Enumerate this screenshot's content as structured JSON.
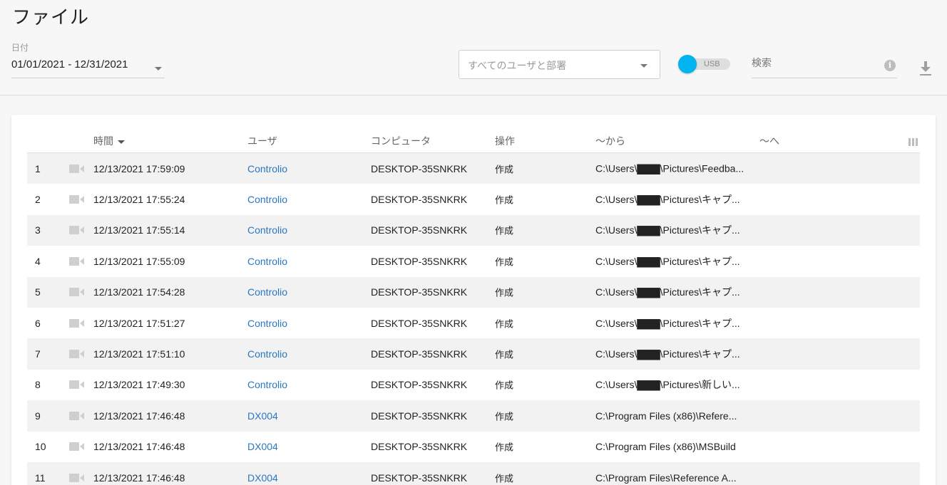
{
  "page": {
    "title": "ファイル"
  },
  "filters": {
    "date_label": "日付",
    "date_value": "01/01/2021 - 12/31/2021",
    "user_select_placeholder": "すべてのユーザと部署",
    "usb_toggle_label": "USB",
    "search_placeholder": "検索",
    "info_icon_glyph": "i"
  },
  "colors": {
    "accent": "#00b4f0",
    "link": "#2a77c0"
  },
  "icons": {
    "row_icon": "video-camera-icon",
    "download": "download-icon",
    "info": "info-icon",
    "columns": "columns-icon"
  },
  "table": {
    "headers": {
      "time": "時間",
      "user": "ユーザ",
      "computer": "コンピュータ",
      "operation": "操作",
      "from": "～から",
      "to": "～へ"
    },
    "rows": [
      {
        "idx": "1",
        "time": "12/13/2021 17:59:09",
        "user": "Controlio",
        "computer": "DESKTOP-35SNKRK",
        "operation": "作成",
        "from": "C:\\Users\\▇▇▇\\Pictures\\Feedba...",
        "to": ""
      },
      {
        "idx": "2",
        "time": "12/13/2021 17:55:24",
        "user": "Controlio",
        "computer": "DESKTOP-35SNKRK",
        "operation": "作成",
        "from": "C:\\Users\\▇▇▇\\Pictures\\キャプ...",
        "to": ""
      },
      {
        "idx": "3",
        "time": "12/13/2021 17:55:14",
        "user": "Controlio",
        "computer": "DESKTOP-35SNKRK",
        "operation": "作成",
        "from": "C:\\Users\\▇▇▇\\Pictures\\キャプ...",
        "to": ""
      },
      {
        "idx": "4",
        "time": "12/13/2021 17:55:09",
        "user": "Controlio",
        "computer": "DESKTOP-35SNKRK",
        "operation": "作成",
        "from": "C:\\Users\\▇▇▇\\Pictures\\キャプ...",
        "to": ""
      },
      {
        "idx": "5",
        "time": "12/13/2021 17:54:28",
        "user": "Controlio",
        "computer": "DESKTOP-35SNKRK",
        "operation": "作成",
        "from": "C:\\Users\\▇▇▇\\Pictures\\キャプ...",
        "to": ""
      },
      {
        "idx": "6",
        "time": "12/13/2021 17:51:27",
        "user": "Controlio",
        "computer": "DESKTOP-35SNKRK",
        "operation": "作成",
        "from": "C:\\Users\\▇▇▇\\Pictures\\キャプ...",
        "to": ""
      },
      {
        "idx": "7",
        "time": "12/13/2021 17:51:10",
        "user": "Controlio",
        "computer": "DESKTOP-35SNKRK",
        "operation": "作成",
        "from": "C:\\Users\\▇▇▇\\Pictures\\キャプ...",
        "to": ""
      },
      {
        "idx": "8",
        "time": "12/13/2021 17:49:30",
        "user": "Controlio",
        "computer": "DESKTOP-35SNKRK",
        "operation": "作成",
        "from": "C:\\Users\\▇▇▇\\Pictures\\新しい...",
        "to": ""
      },
      {
        "idx": "9",
        "time": "12/13/2021 17:46:48",
        "user": "DX004",
        "computer": "DESKTOP-35SNKRK",
        "operation": "作成",
        "from": "C:\\Program Files (x86)\\Refere...",
        "to": ""
      },
      {
        "idx": "10",
        "time": "12/13/2021 17:46:48",
        "user": "DX004",
        "computer": "DESKTOP-35SNKRK",
        "operation": "作成",
        "from": "C:\\Program Files (x86)\\MSBuild",
        "to": ""
      },
      {
        "idx": "11",
        "time": "12/13/2021 17:46:48",
        "user": "DX004",
        "computer": "DESKTOP-35SNKRK",
        "operation": "作成",
        "from": "C:\\Program Files\\Reference A...",
        "to": ""
      }
    ]
  }
}
